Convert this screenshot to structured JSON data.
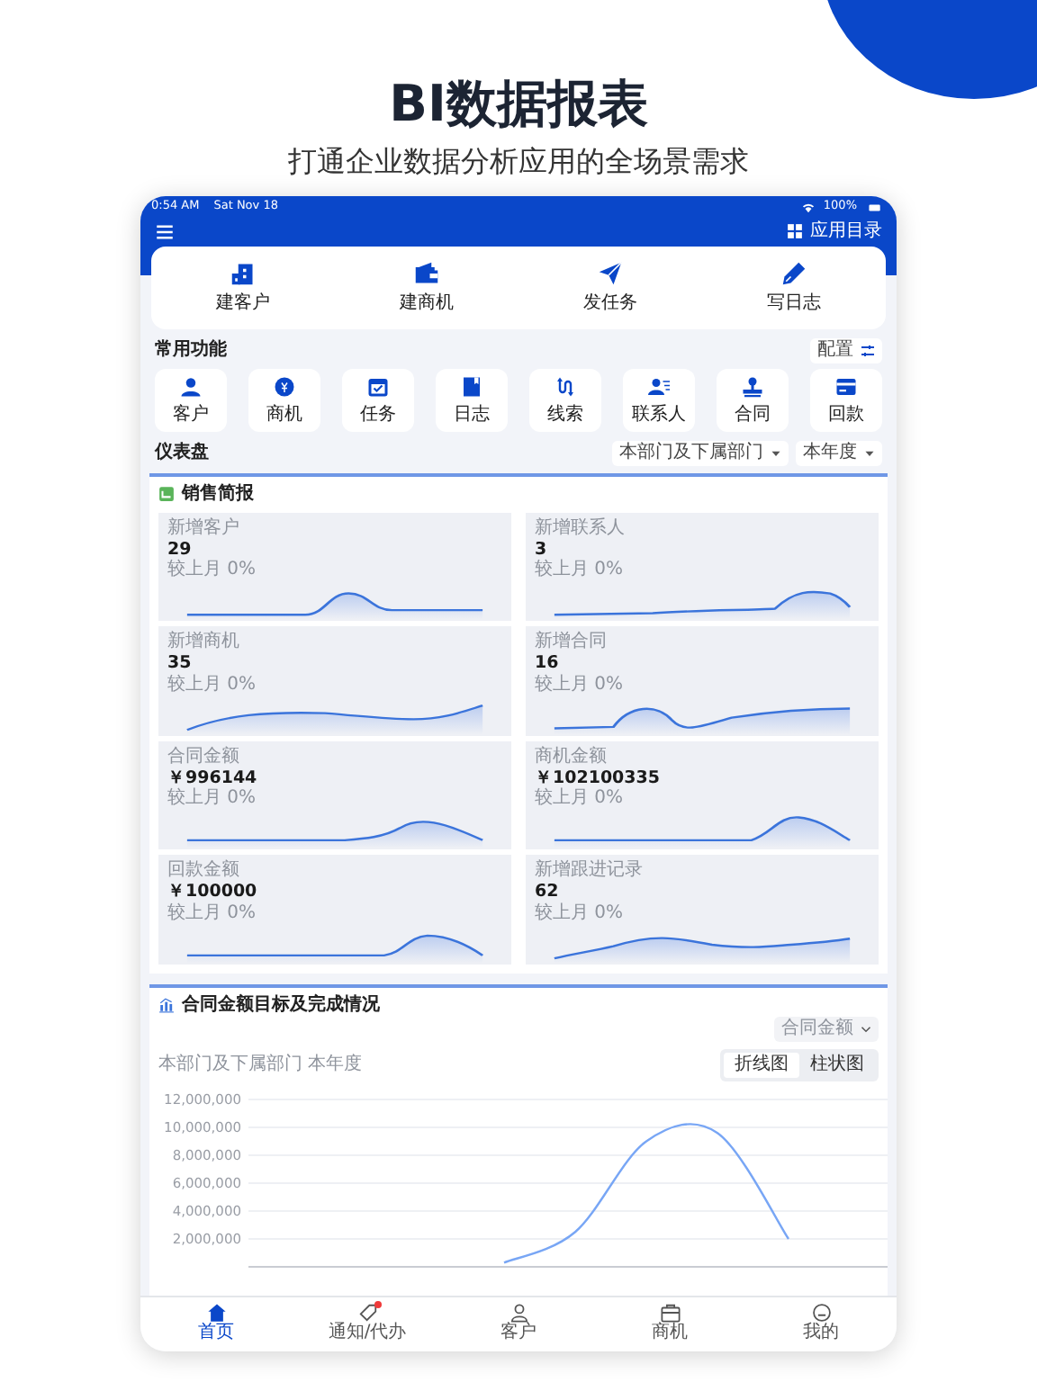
{
  "header": {
    "title": "BI数据报表",
    "subtitle": "打通企业数据分析应用的全场景需求"
  },
  "status_bar": {
    "time": "0:54 AM",
    "date": "Sat Nov 18",
    "battery": "100%"
  },
  "nav_bar": {
    "app_directory": "应用目录"
  },
  "quick_actions": [
    {
      "label": "建客户"
    },
    {
      "label": "建商机"
    },
    {
      "label": "发任务"
    },
    {
      "label": "写日志"
    }
  ],
  "common_functions": {
    "title": "常用功能",
    "config_button": "配置",
    "items": [
      {
        "label": "客户"
      },
      {
        "label": "商机"
      },
      {
        "label": "任务"
      },
      {
        "label": "日志"
      },
      {
        "label": "线索"
      },
      {
        "label": "联系人"
      },
      {
        "label": "合同"
      },
      {
        "label": "回款"
      }
    ]
  },
  "dashboard": {
    "title": "仪表盘",
    "filters": [
      {
        "label": "本部门及下属部门"
      },
      {
        "label": "本年度"
      }
    ]
  },
  "sales_brief": {
    "title": "销售简报",
    "cards": [
      {
        "label": "新增客户",
        "value": "29",
        "comparison": "较上月 0%"
      },
      {
        "label": "新增联系人",
        "value": "3",
        "comparison": "较上月 0%"
      },
      {
        "label": "新增商机",
        "value": "35",
        "comparison": "较上月 0%"
      },
      {
        "label": "新增合同",
        "value": "16",
        "comparison": "较上月 0%"
      },
      {
        "label": "合同金额",
        "value": "￥996144",
        "comparison": "较上月 0%"
      },
      {
        "label": "商机金额",
        "value": "￥102100335",
        "comparison": "较上月 0%"
      },
      {
        "label": "回款金额",
        "value": "￥100000",
        "comparison": "较上月 0%"
      },
      {
        "label": "新增跟进记录",
        "value": "62",
        "comparison": "较上月 0%"
      }
    ]
  },
  "target_chart": {
    "title": "合同金额目标及完成情况",
    "metric_select": "合同金额",
    "scope": "本部门及下属部门 本年度",
    "view_toggle": [
      {
        "label": "折线图",
        "selected": true
      },
      {
        "label": "柱状图",
        "selected": false
      }
    ],
    "chart_data": {
      "type": "line",
      "ylim": [
        0,
        12000000
      ],
      "yticks": [
        {
          "value": 2000000,
          "label": "2,000,000"
        },
        {
          "value": 4000000,
          "label": "4,000,000"
        },
        {
          "value": 6000000,
          "label": "6,000,000"
        },
        {
          "value": 8000000,
          "label": "8,000,000"
        },
        {
          "value": 10000000,
          "label": "10,000,000"
        },
        {
          "value": 12000000,
          "label": "12,000,000"
        }
      ],
      "grid": true,
      "series": [
        {
          "color": "#78a6f5",
          "values": [
            null,
            null,
            null,
            300000,
            2500000,
            9000000,
            9600000,
            2000000,
            null
          ]
        }
      ]
    }
  },
  "tab_bar": [
    {
      "label": "首页",
      "selected": true,
      "badge": false
    },
    {
      "label": "通知/代办",
      "selected": false,
      "badge": true
    },
    {
      "label": "客户",
      "selected": false,
      "badge": false
    },
    {
      "label": "商机",
      "selected": false,
      "badge": false
    },
    {
      "label": "我的",
      "selected": false,
      "badge": false
    }
  ]
}
